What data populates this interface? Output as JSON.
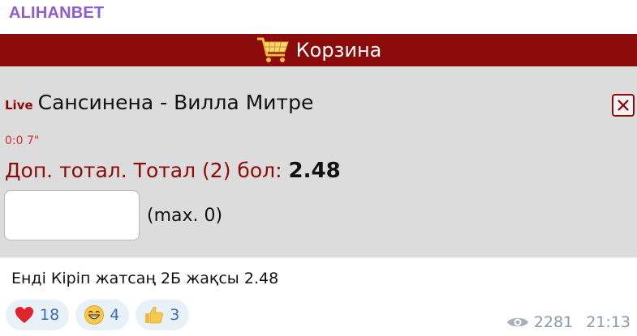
{
  "channel": {
    "name": "ALIHANBET"
  },
  "cart": {
    "title": "Корзина",
    "icon": "shopping-cart-icon"
  },
  "bet": {
    "live_label": "Live",
    "match": "Сансинена - Вилла Митре",
    "score_time": "0:0 7\"",
    "market": "Доп. тотал. Тотал (2) бол:",
    "odds": "2.48",
    "stake_value": "",
    "max_label": "(max. 0)"
  },
  "message": {
    "text": "Енді Кіріп жатсаң 2Б жақсы 2.48"
  },
  "reactions": [
    {
      "emoji": "heart-icon",
      "count": "18"
    },
    {
      "emoji": "grinning-face-icon",
      "count": "4"
    },
    {
      "emoji": "thumbs-up-icon",
      "count": "3"
    }
  ],
  "meta": {
    "views": "2281",
    "time": "21:13"
  },
  "colors": {
    "brand": "#8e5bd1",
    "accent": "#8b0a0a",
    "card_bg": "#dcdcdc",
    "reaction_bg": "#e8f0f8"
  }
}
